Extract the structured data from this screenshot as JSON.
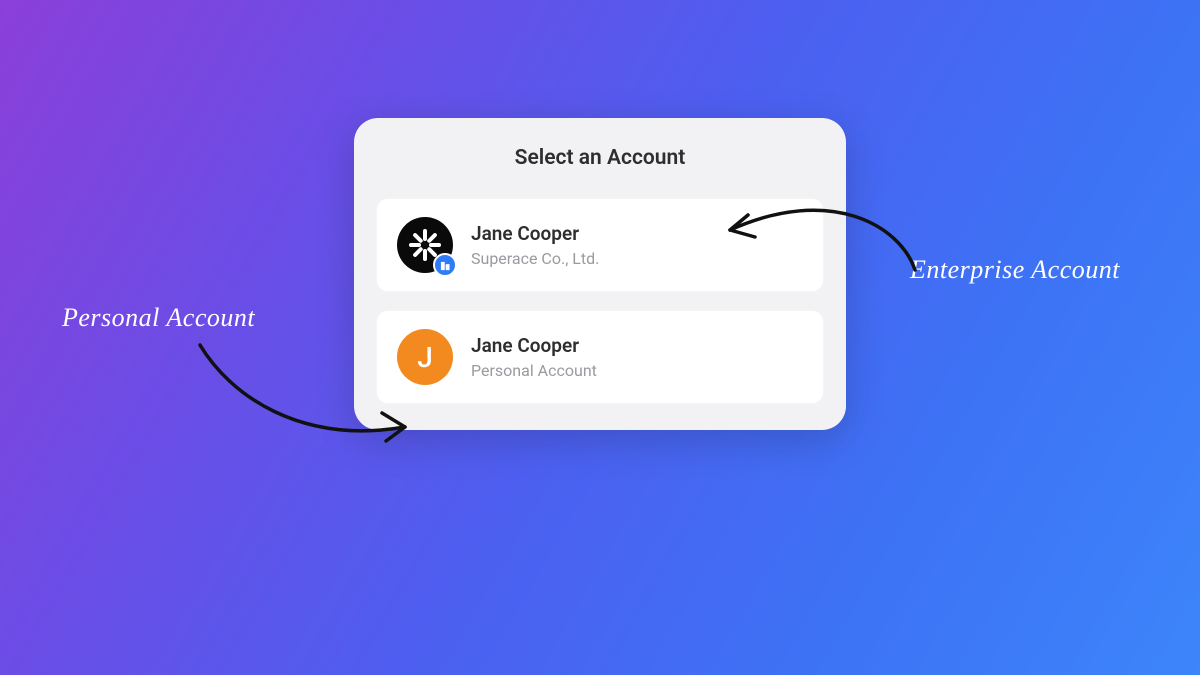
{
  "modal": {
    "title": "Select an Account",
    "accounts": [
      {
        "name": "Jane Cooper",
        "subtitle": "Superace Co., Ltd.",
        "avatar_letter": "",
        "avatar_type": "enterprise"
      },
      {
        "name": "Jane Cooper",
        "subtitle": "Personal Account",
        "avatar_letter": "J",
        "avatar_type": "personal"
      }
    ]
  },
  "annotations": {
    "personal": "Personal Account",
    "enterprise": "Enterprise Account"
  }
}
